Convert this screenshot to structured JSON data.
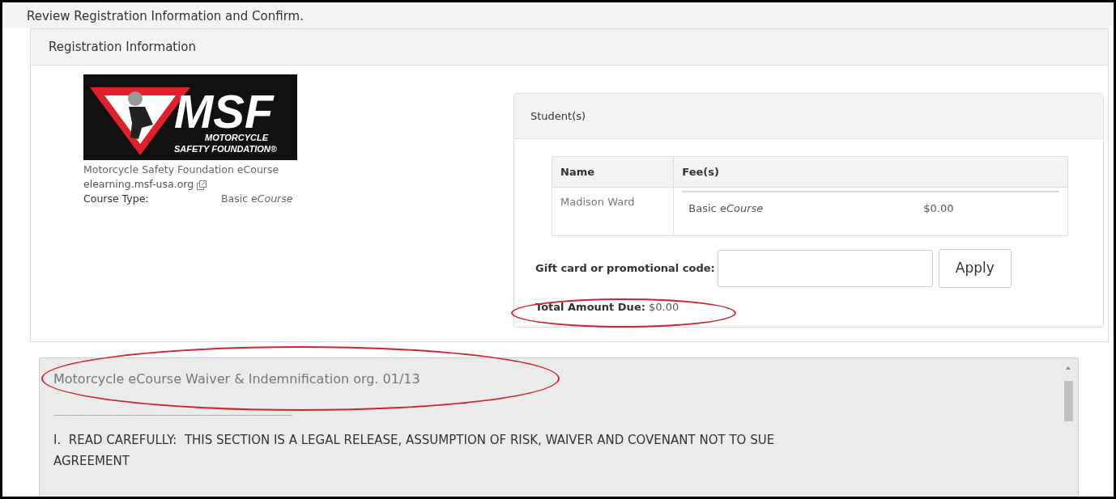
{
  "page_title": "Review Registration Information and Confirm.",
  "panel_title": "Registration Information",
  "course": {
    "logo": {
      "mark": "MSF",
      "line_1": "MOTORCYCLE",
      "line_2": "SAFETY FOUNDATION®"
    },
    "name": "Motorcycle Safety Foundation eCourse",
    "link": "elearning.msf-usa.org",
    "type_label": "Course Type:",
    "type_value": [
      {
        "text": "Basic e",
        "italic": false
      },
      {
        "text": "Course",
        "italic": true
      }
    ]
  },
  "students": {
    "title": "Student(s)",
    "columns": [
      "Name",
      "Fee(s)"
    ],
    "rows": [
      {
        "name": "Madison Ward",
        "fees": [
          {
            "item": [
              {
                "text": "Basic e",
                "italic": false
              },
              {
                "text": "Course",
                "italic": true
              }
            ],
            "amount": "$0.00"
          }
        ]
      }
    ],
    "promo": {
      "label": "Gift card or promotional code:",
      "button": "Apply"
    },
    "total": {
      "label": "Total Amount Due:",
      "value": "$0.00"
    }
  },
  "waiver": {
    "title": "Motorcycle eCourse Waiver & Indemnification org. 01/13",
    "separator": "----------------------------------------------------------------------------------------------------",
    "paragraphs": [
      "I.  READ CAREFULLY:  THIS SECTION IS A LEGAL RELEASE, ASSUMPTION OF RISK, WAIVER AND COVENANT NOT TO SUE AGREEMENT"
    ]
  }
}
